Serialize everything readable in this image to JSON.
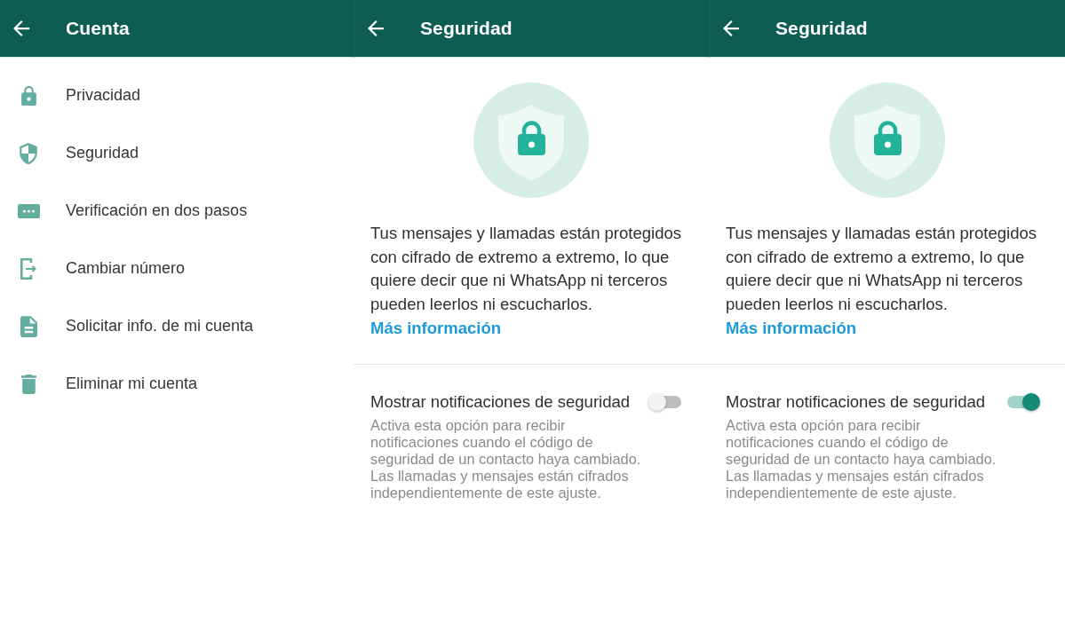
{
  "panels": [
    {
      "kind": "menu",
      "header": {
        "title": "Cuenta"
      },
      "items": [
        {
          "label": "Privacidad"
        },
        {
          "label": "Seguridad"
        },
        {
          "label": "Verificación en dos pasos"
        },
        {
          "label": "Cambiar número"
        },
        {
          "label": "Solicitar info. de mi cuenta"
        },
        {
          "label": "Eliminar mi cuenta"
        }
      ]
    },
    {
      "kind": "security",
      "header": {
        "title": "Seguridad"
      },
      "intro": {
        "text": "Tus mensajes y llamadas están protegidos con cifrado de extremo a extremo, lo que quiere decir que ni WhatsApp ni terceros pueden leerlos ni escucharlos.",
        "link": "Más información"
      },
      "setting": {
        "title": "Mostrar notificaciones de seguridad",
        "description": "Activa esta opción para recibir notificaciones cuando el código de seguridad de un contacto haya cambiado. Las llamadas y mensajes están cifrados independientemente de este ajuste.",
        "on": false
      }
    },
    {
      "kind": "security",
      "header": {
        "title": "Seguridad"
      },
      "intro": {
        "text": "Tus mensajes y llamadas están protegidos con cifrado de extremo a extremo, lo que quiere decir que ni WhatsApp ni terceros pueden leerlos ni escucharlos.",
        "link": "Más información"
      },
      "setting": {
        "title": "Mostrar notificaciones de seguridad",
        "description": "Activa esta opción para recibir notificaciones cuando el código de seguridad de un contacto haya cambiado. Las llamadas y mensajes están cifrados independientemente de este ajuste.",
        "on": true
      }
    }
  ]
}
